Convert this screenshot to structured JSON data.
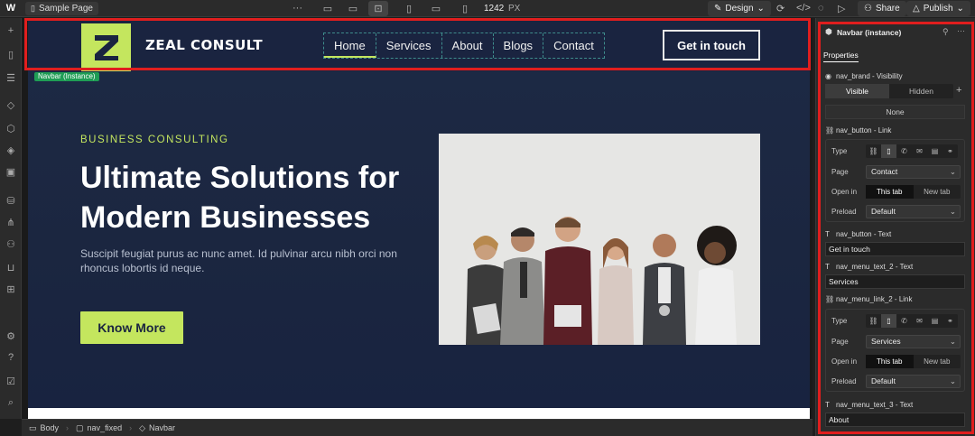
{
  "topbar": {
    "page_name": "Sample Page",
    "more": "···",
    "width_value": "1242",
    "width_unit": "PX",
    "design_label": "Design",
    "share_label": "Share",
    "publish_label": "Publish"
  },
  "site": {
    "brand_name": "ZEAL CONSULT",
    "brand_letter": "Z",
    "nav_links": [
      "Home",
      "Services",
      "About",
      "Blogs",
      "Contact"
    ],
    "nav_cta": "Get in touch",
    "selection_badge": "Navbar (Instance)",
    "eyebrow": "BUSINESS CONSULTING",
    "hero_title": "Ultimate Solutions for Modern Businesses",
    "hero_text": "Suscipit feugiat purus ac nunc amet. Id pulvinar arcu nibh orci non rhoncus lobortis id neque.",
    "hero_cta": "Know More"
  },
  "breadcrumbs": [
    "Body",
    "nav_fixed",
    "Navbar"
  ],
  "panel": {
    "title": "Navbar (instance)",
    "tab": "Properties",
    "visibility_label": "nav_brand - Visibility",
    "visibility_options": [
      "Visible",
      "Hidden"
    ],
    "none_label": "None",
    "link1_label": "nav_button - Link",
    "type_label": "Type",
    "page_label": "Page",
    "page1_value": "Contact",
    "open_in_label": "Open in",
    "open_options": [
      "This tab",
      "New tab"
    ],
    "preload_label": "Preload",
    "preload_value": "Default",
    "text1_label": "nav_button - Text",
    "text1_value": "Get in touch",
    "text2_label": "nav_menu_text_2 - Text",
    "text2_value": "Services",
    "link2_label": "nav_menu_link_2 - Link",
    "page2_value": "Services",
    "text3_label": "nav_menu_text_3 - Text",
    "text3_value": "About"
  },
  "colors": {
    "accent": "#c4e65e",
    "navy": "#1a2440",
    "highlight": "#e01e1e"
  }
}
